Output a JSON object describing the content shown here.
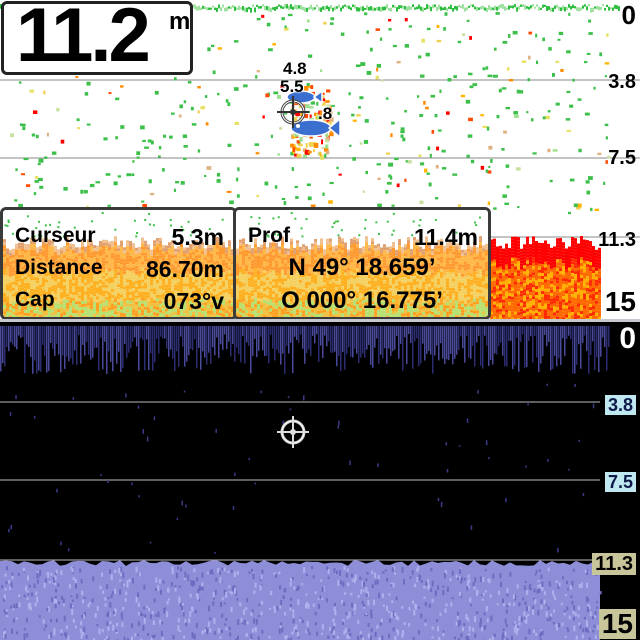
{
  "depth_readout": {
    "value": "11.2",
    "unit": "m"
  },
  "top_scale": [
    "0",
    "3.8",
    "7.5",
    "11.3",
    "15"
  ],
  "bottom_scale": [
    "0",
    "3.8",
    "7.5",
    "11.3",
    "15"
  ],
  "fish_targets": {
    "top": "4.8",
    "mid": "5.5",
    "low": ".8"
  },
  "cursor_panel": {
    "rows": [
      {
        "label": "Curseur",
        "value": "5.3m"
      },
      {
        "label": "Distance",
        "value": "86.70m"
      },
      {
        "label": "Cap",
        "value": "073°v"
      }
    ]
  },
  "position_panel": {
    "depth_label": "Prof",
    "depth_value": "11.4m",
    "latitude": "N  49° 18.659’",
    "longitude": "O  000° 16.775’"
  },
  "colors": {
    "top_background": "#ffffff",
    "bottom_background": "#000000",
    "bottom_return": "#8e8ed8",
    "bottom_scale_highlight": "#bfe8f0"
  },
  "icons": {
    "cursor": "crosshair-cursor-icon",
    "fish": "fish-icon"
  }
}
